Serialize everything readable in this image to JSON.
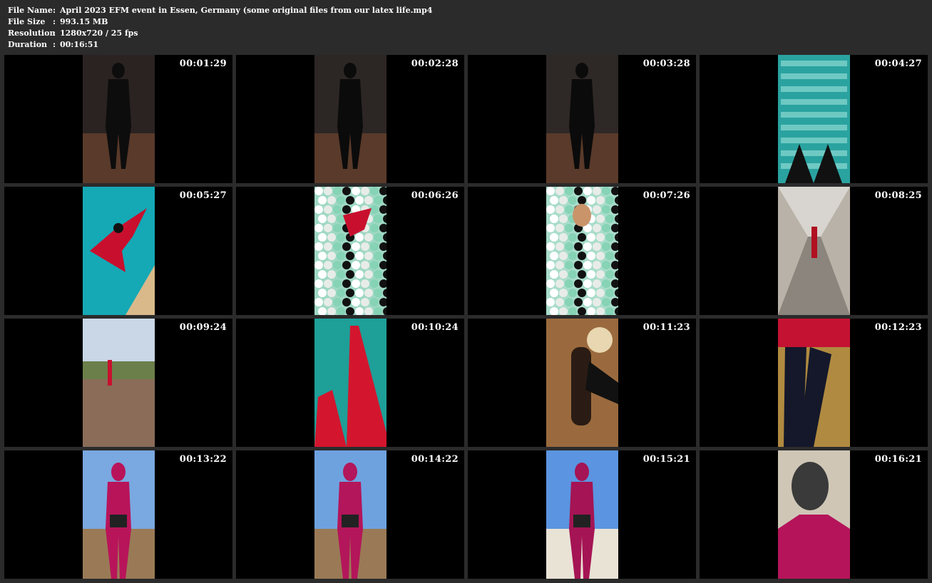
{
  "info": {
    "rows": [
      {
        "label": "File Name",
        "value": "April 2023 EFM event in Essen, Germany (some original files from our latex life.mp4"
      },
      {
        "label": "File Size",
        "value": "993.15 MB"
      },
      {
        "label": "Resolution",
        "value": "1280x720 / 25 fps"
      },
      {
        "label": "Duration",
        "value": "00:16:51"
      }
    ],
    "separator": ":"
  },
  "thumbnails": [
    {
      "timestamp": "00:01:29",
      "scene": "dark-studio-closeup",
      "colors": {
        "bg": "#2a2321",
        "fg": "#0d0d0d"
      }
    },
    {
      "timestamp": "00:02:28",
      "scene": "dark-studio-standing",
      "colors": {
        "bg": "#2c2725",
        "fg": "#0b0b0b"
      }
    },
    {
      "timestamp": "00:03:28",
      "scene": "dark-studio-seated",
      "colors": {
        "bg": "#2e2826",
        "fg": "#0b0b0b"
      }
    },
    {
      "timestamp": "00:04:27",
      "scene": "pool-steps",
      "colors": {
        "bg": "#2aa3a0",
        "fg": "#111111"
      }
    },
    {
      "timestamp": "00:05:27",
      "scene": "swimming-pool",
      "colors": {
        "bg": "#14a9b5",
        "fg": "#c8102e"
      }
    },
    {
      "timestamp": "00:06:26",
      "scene": "ball-pit",
      "colors": {
        "bg": "#9fd8c4",
        "fg": "#111111"
      }
    },
    {
      "timestamp": "00:07:26",
      "scene": "ball-pit-face",
      "colors": {
        "bg": "#a8dccb",
        "fg": "#151515"
      }
    },
    {
      "timestamp": "00:08:25",
      "scene": "hallway",
      "colors": {
        "bg": "#b9b2a8",
        "fg": "#b01020"
      }
    },
    {
      "timestamp": "00:09:24",
      "scene": "park-path",
      "colors": {
        "bg": "#8c7a68",
        "fg": "#c8102e"
      }
    },
    {
      "timestamp": "00:10:24",
      "scene": "pool-legs",
      "colors": {
        "bg": "#1e9f98",
        "fg": "#d3162e"
      }
    },
    {
      "timestamp": "00:11:23",
      "scene": "wooden-table",
      "colors": {
        "bg": "#9a6a3e",
        "fg": "#2a1c14"
      }
    },
    {
      "timestamp": "00:12:23",
      "scene": "boots-closeup",
      "colors": {
        "bg": "#b08a40",
        "fg": "#14182a"
      }
    },
    {
      "timestamp": "00:13:22",
      "scene": "outdoor-pink",
      "colors": {
        "bg": "#7aa8e0",
        "fg": "#b8145a"
      }
    },
    {
      "timestamp": "00:14:22",
      "scene": "outdoor-pink-crane",
      "colors": {
        "bg": "#6ea2df",
        "fg": "#b3165a"
      }
    },
    {
      "timestamp": "00:15:21",
      "scene": "sand-back",
      "colors": {
        "bg": "#5b94e0",
        "fg": "#a51454"
      }
    },
    {
      "timestamp": "00:16:21",
      "scene": "stone-wall-closeup",
      "colors": {
        "bg": "#cfc6b6",
        "fg": "#b5145a"
      }
    }
  ]
}
